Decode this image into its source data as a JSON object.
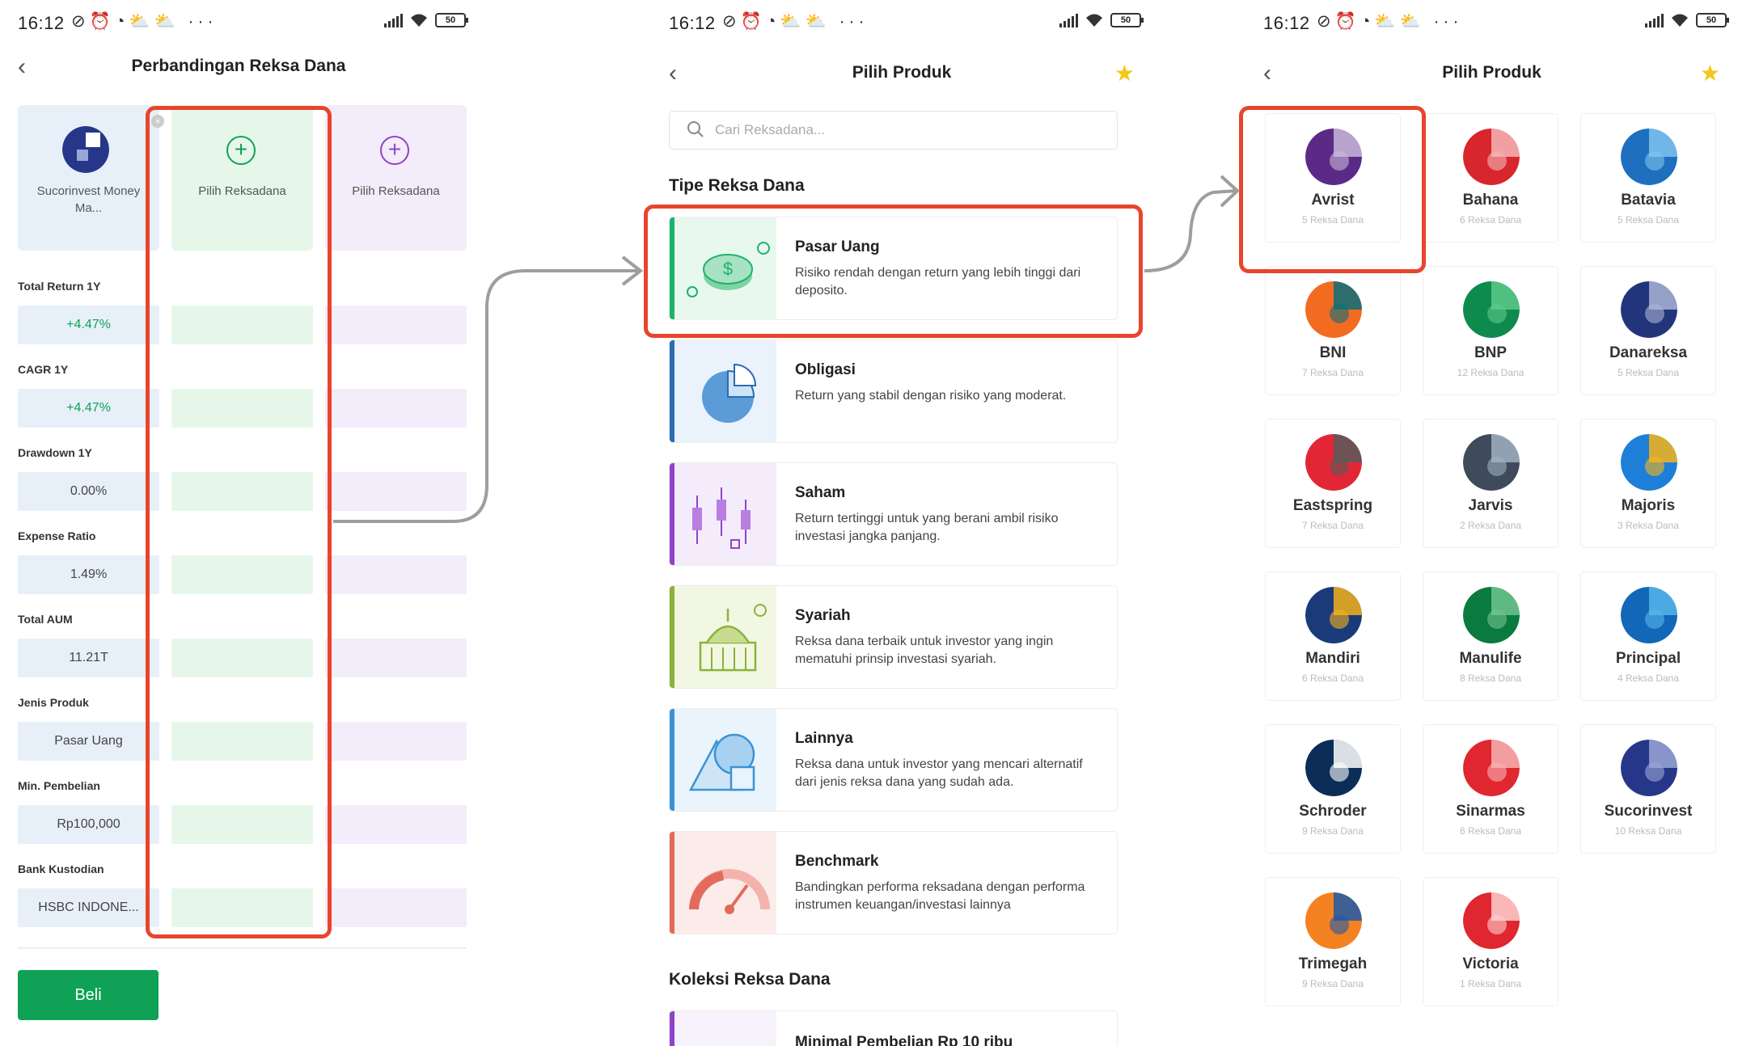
{
  "status": {
    "time": "16:12",
    "battery": "50"
  },
  "panel1": {
    "title": "Perbandingan Reksa Dana",
    "slots": [
      {
        "label": "Sucorinvest Money Ma..."
      },
      {
        "label": "Pilih Reksadana"
      },
      {
        "label": "Pilih Reksadana"
      }
    ],
    "metrics": [
      {
        "label": "Total Return 1Y",
        "value": "+4.47%"
      },
      {
        "label": "CAGR 1Y",
        "value": "+4.47%"
      },
      {
        "label": "Drawdown 1Y",
        "value": "0.00%"
      },
      {
        "label": "Expense Ratio",
        "value": "1.49%"
      },
      {
        "label": "Total AUM",
        "value": "11.21T"
      },
      {
        "label": "Jenis Produk",
        "value": "Pasar Uang"
      },
      {
        "label": "Min. Pembelian",
        "value": "Rp100,000"
      },
      {
        "label": "Bank Kustodian",
        "value": "HSBC INDONE..."
      }
    ],
    "buy_label": "Beli",
    "colors": {
      "green": "#0fa257",
      "slot2": "#e6f7ea",
      "slot3": "#f3ecfa",
      "slot1": "#e7f0f9"
    }
  },
  "panel2": {
    "title": "Pilih Produk",
    "search_placeholder": "Cari Reksadana...",
    "section_type": "Tipe Reksa Dana",
    "types": [
      {
        "name": "Pasar Uang",
        "desc": "Risiko rendah dengan return yang lebih tinggi dari deposito.",
        "color": "#1db36b",
        "icon": "coin-stack-icon"
      },
      {
        "name": "Obligasi",
        "desc": "Return yang stabil dengan risiko yang moderat.",
        "color": "#2b6cb0",
        "icon": "pie-chart-icon"
      },
      {
        "name": "Saham",
        "desc": "Return tertinggi untuk yang berani ambil risiko investasi jangka panjang.",
        "color": "#8e44c8",
        "icon": "candlestick-icon"
      },
      {
        "name": "Syariah",
        "desc": "Reksa dana terbaik untuk investor yang ingin mematuhi prinsip investasi syariah.",
        "color": "#8bb23a",
        "icon": "mosque-icon"
      },
      {
        "name": "Lainnya",
        "desc": "Reksa dana untuk investor yang mencari alternatif dari jenis reksa dana yang sudah ada.",
        "color": "#3b93d6",
        "icon": "shapes-icon"
      },
      {
        "name": "Benchmark",
        "desc": "Bandingkan performa reksadana dengan performa instrumen keuangan/investasi lainnya",
        "color": "#e36a5c",
        "icon": "gauge-icon"
      }
    ],
    "section_collection": "Koleksi Reksa Dana",
    "collection_first": "Minimal Pembelian Rp 10 ribu"
  },
  "panel3": {
    "title": "Pilih Produk",
    "managers": [
      {
        "name": "Avrist",
        "count": "5 Reksa Dana",
        "c1": "#5b2a86",
        "c2": "#c9b8d8"
      },
      {
        "name": "Bahana",
        "count": "6 Reksa Dana",
        "c1": "#d8262e",
        "c2": "#f4b6b6"
      },
      {
        "name": "Batavia",
        "count": "5 Reksa Dana",
        "c1": "#1f6fbf",
        "c2": "#7fc4ee"
      },
      {
        "name": "BNI",
        "count": "7 Reksa Dana",
        "c1": "#f26b21",
        "c2": "#0b6f7a"
      },
      {
        "name": "BNP",
        "count": "12 Reksa Dana",
        "c1": "#0f8a4f",
        "c2": "#5cc98a"
      },
      {
        "name": "Danareksa",
        "count": "5 Reksa Dana",
        "c1": "#23357a",
        "c2": "#aab3d6"
      },
      {
        "name": "Eastspring",
        "count": "7 Reksa Dana",
        "c1": "#e32636",
        "c2": "#5a5a5a"
      },
      {
        "name": "Jarvis",
        "count": "2 Reksa Dana",
        "c1": "#3f4a5a",
        "c2": "#9fb0c2"
      },
      {
        "name": "Majoris",
        "count": "3 Reksa Dana",
        "c1": "#1e7fd8",
        "c2": "#f6b519"
      },
      {
        "name": "Mandiri",
        "count": "6 Reksa Dana",
        "c1": "#1b3a7a",
        "c2": "#f5b21b"
      },
      {
        "name": "Manulife",
        "count": "8 Reksa Dana",
        "c1": "#0a7a3f",
        "c2": "#6fc48f"
      },
      {
        "name": "Principal",
        "count": "4 Reksa Dana",
        "c1": "#1267b8",
        "c2": "#56b6e8"
      },
      {
        "name": "Schroder",
        "count": "9 Reksa Dana",
        "c1": "#0c2d57",
        "c2": "#ffffff"
      },
      {
        "name": "Sinarmas",
        "count": "6 Reksa Dana",
        "c1": "#e0262e",
        "c2": "#f7b3b5"
      },
      {
        "name": "Sucorinvest",
        "count": "10 Reksa Dana",
        "c1": "#26378a",
        "c2": "#9aa6d6"
      },
      {
        "name": "Trimegah",
        "count": "9 Reksa Dana",
        "c1": "#f58220",
        "c2": "#1e5aa8"
      },
      {
        "name": "Victoria",
        "count": "1 Reksa Dana",
        "c1": "#e0262e",
        "c2": "#ffd0d0"
      }
    ]
  },
  "highlight_color": "#e8452c"
}
